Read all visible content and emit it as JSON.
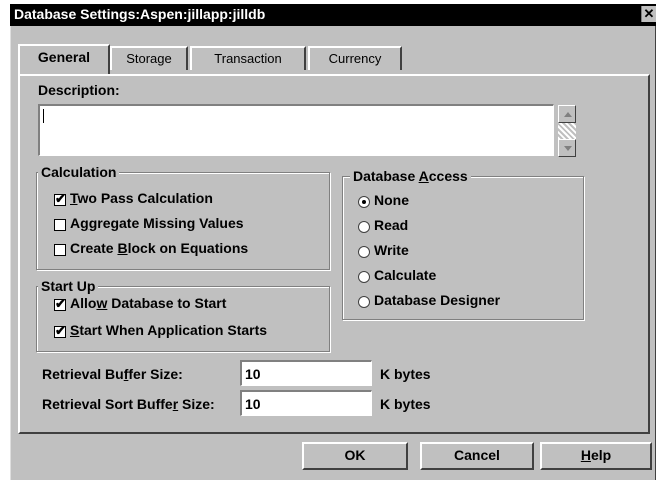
{
  "window": {
    "title": "Database Settings:Aspen:jillapp:jilldb",
    "close_glyph": "✕"
  },
  "tabs": [
    {
      "label": "General"
    },
    {
      "label": "Storage"
    },
    {
      "label": "Transaction"
    },
    {
      "label": "Currency"
    }
  ],
  "description": {
    "label": "Description:",
    "value": ""
  },
  "calculation": {
    "title": "Calculation",
    "options": [
      {
        "pre": "",
        "u": "T",
        "post": "wo Pass Calculation",
        "checked": true
      },
      {
        "pre": "A",
        "u": "g",
        "post": "gregate Missing Values",
        "checked": false
      },
      {
        "pre": "Create ",
        "u": "B",
        "post": "lock on Equations",
        "checked": false
      }
    ]
  },
  "startup": {
    "title": "Start Up",
    "options": [
      {
        "pre": "Allo",
        "u": "w",
        "post": " Database to Start",
        "checked": true
      },
      {
        "pre": "",
        "u": "S",
        "post": "tart When Application Starts",
        "checked": true
      }
    ]
  },
  "database_access": {
    "title_pre": "Database ",
    "title_u": "A",
    "title_post": "ccess",
    "options": [
      {
        "label": "None",
        "selected": true
      },
      {
        "label": "Read",
        "selected": false
      },
      {
        "label": "Write",
        "selected": false
      },
      {
        "label": "Calculate",
        "selected": false
      },
      {
        "label": "Database Designer",
        "selected": false
      }
    ]
  },
  "retrieval_buffer": {
    "label_pre": "Retrieval Bu",
    "label_u": "f",
    "label_post": "fer Size:",
    "value": "10",
    "unit": "K bytes"
  },
  "retrieval_sort_buffer": {
    "label_pre": "Retrieval Sort Buffe",
    "label_u": "r",
    "label_post": " Size:",
    "value": "10",
    "unit": "K bytes"
  },
  "buttons": {
    "ok": "OK",
    "cancel": "Cancel",
    "help_u": "H",
    "help_post": "elp"
  }
}
